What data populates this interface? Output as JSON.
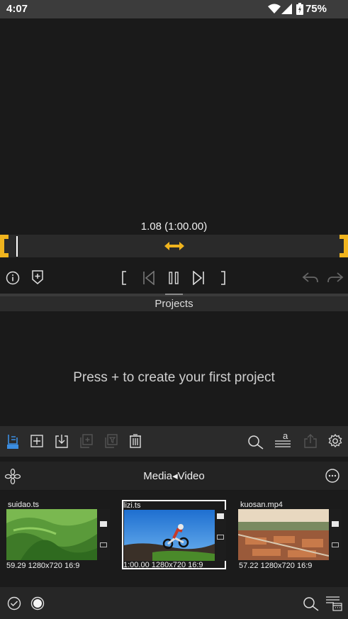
{
  "status_bar": {
    "time": "4:07",
    "battery": "75%"
  },
  "player": {
    "timecode": "1.08 (1:00.00)"
  },
  "projects": {
    "header": "Projects",
    "empty_message": "Press + to create your first project"
  },
  "media": {
    "title": "Media◂Video"
  },
  "clips": [
    {
      "name": "suidao.ts",
      "info": "59.29 1280x720 16:9"
    },
    {
      "name": "lizi.ts",
      "info": "1:00.00 1280x720 16:9"
    },
    {
      "name": "kuosan.mp4",
      "info": "57.22 1280x720 16:9"
    }
  ],
  "colors": {
    "accent": "#f0b41e",
    "blue_icon": "#3b8de0",
    "selected_border": "#ffffff"
  }
}
